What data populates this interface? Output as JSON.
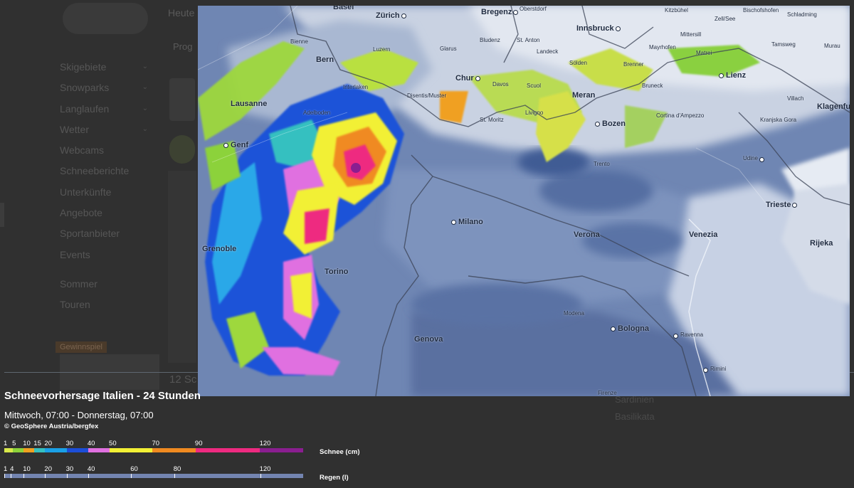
{
  "background": {
    "nav": [
      "Heute",
      "…"
    ],
    "sub_nav": "Prog",
    "menu": [
      {
        "label": "Skigebiete",
        "chevron": true
      },
      {
        "label": "Snowparks",
        "chevron": true
      },
      {
        "label": "Langlaufen",
        "chevron": true
      },
      {
        "label": "Wetter",
        "chevron": true
      },
      {
        "label": "Webcams",
        "chevron": false
      },
      {
        "label": "Schneeberichte",
        "chevron": false
      },
      {
        "label": "Unterkünfte",
        "chevron": false
      },
      {
        "label": "Angebote",
        "chevron": false
      },
      {
        "label": "Sportanbieter",
        "chevron": false
      },
      {
        "label": "Events",
        "chevron": false
      }
    ],
    "menu2": [
      "Sommer",
      "Touren"
    ],
    "badge": "Gewinnspiel",
    "card_title": "12 Sc",
    "right_list": [
      "Sardinien",
      "Basilikata"
    ]
  },
  "caption": {
    "title": "Schneevorhersage Italien - 24 Stunden",
    "time_range": "Mittwoch, 07:00 - Donnerstag, 07:00",
    "credit": "© GeoSphere Austria/bergfex"
  },
  "snow_legend": {
    "unit": "Schnee (cm)",
    "ticks": [
      "1",
      "5",
      "10",
      "15",
      "20",
      "30",
      "40",
      "50",
      "70",
      "90",
      "120"
    ],
    "segments": [
      {
        "from": 1,
        "to": 5,
        "color": "#d8e84a"
      },
      {
        "from": 5,
        "to": 10,
        "color": "#8cd23a"
      },
      {
        "from": 10,
        "to": 15,
        "color": "#f0a020"
      },
      {
        "from": 15,
        "to": 20,
        "color": "#36c0c0"
      },
      {
        "from": 20,
        "to": 30,
        "color": "#1aa0e6"
      },
      {
        "from": 30,
        "to": 40,
        "color": "#1c4ed8"
      },
      {
        "from": 40,
        "to": 50,
        "color": "#e070e0"
      },
      {
        "from": 50,
        "to": 70,
        "color": "#f2f035"
      },
      {
        "from": 70,
        "to": 90,
        "color": "#f08a20"
      },
      {
        "from": 90,
        "to": 120,
        "color": "#ee2a80"
      },
      {
        "from": 120,
        "to": 140,
        "color": "#8a1e90"
      }
    ]
  },
  "rain_legend": {
    "unit": "Regen (l)",
    "ticks": [
      "1",
      "4",
      "10",
      "20",
      "30",
      "40",
      "60",
      "80",
      "120"
    ],
    "color": "#7384b0"
  },
  "map": {
    "cities": [
      {
        "name": "Basel",
        "big": true
      },
      {
        "name": "Zürich",
        "big": true
      },
      {
        "name": "Bregenz",
        "big": true
      },
      {
        "name": "Oberstdorf",
        "big": false
      },
      {
        "name": "Kitzbühel",
        "big": false
      },
      {
        "name": "Zell/See",
        "big": false
      },
      {
        "name": "Bischofshofen",
        "big": false
      },
      {
        "name": "Schladming",
        "big": false
      },
      {
        "name": "Innsbruck",
        "big": true
      },
      {
        "name": "Mittersill",
        "big": false
      },
      {
        "name": "Tamsweg",
        "big": false
      },
      {
        "name": "Murau",
        "big": false
      },
      {
        "name": "Bludenz",
        "big": false
      },
      {
        "name": "St. Anton",
        "big": false
      },
      {
        "name": "Landeck",
        "big": false
      },
      {
        "name": "Mayrhofen",
        "big": false
      },
      {
        "name": "Matrei",
        "big": false
      },
      {
        "name": "Brenner",
        "big": false
      },
      {
        "name": "Sölden",
        "big": false
      },
      {
        "name": "Lienz",
        "big": true
      },
      {
        "name": "Villach",
        "big": false
      },
      {
        "name": "Klagenfurt",
        "big": true
      },
      {
        "name": "Bienne",
        "big": false
      },
      {
        "name": "Bern",
        "big": true
      },
      {
        "name": "Luzern",
        "big": false
      },
      {
        "name": "Glarus",
        "big": false
      },
      {
        "name": "Chur",
        "big": true
      },
      {
        "name": "Davos",
        "big": false
      },
      {
        "name": "Scuol",
        "big": false
      },
      {
        "name": "Meran",
        "big": true
      },
      {
        "name": "Bruneck",
        "big": false
      },
      {
        "name": "Lausanne",
        "big": true
      },
      {
        "name": "Interlaken",
        "big": false
      },
      {
        "name": "Disentis/Muster",
        "big": false
      },
      {
        "name": "Livigno",
        "big": false
      },
      {
        "name": "Bozen",
        "big": true
      },
      {
        "name": "Cortina d'Ampezzo",
        "big": false
      },
      {
        "name": "Kranjska Gora",
        "big": false
      },
      {
        "name": "Adelboden",
        "big": false
      },
      {
        "name": "St. Moritz",
        "big": false
      },
      {
        "name": "Genf",
        "big": true
      },
      {
        "name": "Trento",
        "big": false
      },
      {
        "name": "Udine",
        "big": false
      },
      {
        "name": "Trieste",
        "big": true
      },
      {
        "name": "Milano",
        "big": true
      },
      {
        "name": "Verona",
        "big": true
      },
      {
        "name": "Venezia",
        "big": true
      },
      {
        "name": "Rijeka",
        "big": true
      },
      {
        "name": "Grenoble",
        "big": true
      },
      {
        "name": "Torino",
        "big": true
      },
      {
        "name": "Modena",
        "big": false
      },
      {
        "name": "Bologna",
        "big": true
      },
      {
        "name": "Ravenna",
        "big": false
      },
      {
        "name": "Genova",
        "big": true
      },
      {
        "name": "Rimini",
        "big": false
      },
      {
        "name": "Firenze",
        "big": false
      }
    ]
  }
}
